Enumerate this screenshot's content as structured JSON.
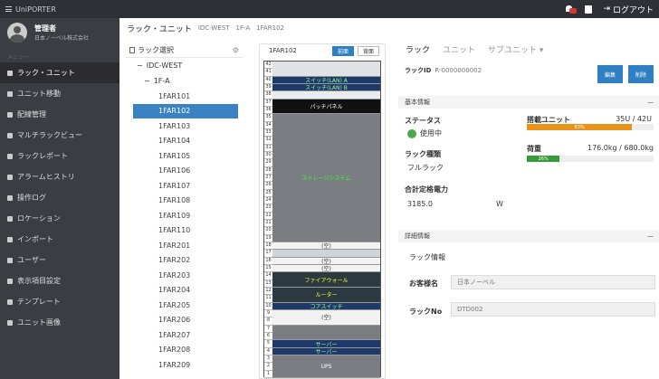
{
  "topbar": {
    "app_title": "UniPORTER",
    "logout": "ログアウト"
  },
  "user": {
    "name": "管理者",
    "company": "日本ノーベル株式会社"
  },
  "menu": {
    "header": "メニュー",
    "items": [
      {
        "label": "ラック・ユニット"
      },
      {
        "label": "ユニット移動"
      },
      {
        "label": "配線管理"
      },
      {
        "label": "マルチラックビュー"
      },
      {
        "label": "ラックレポート"
      },
      {
        "label": "アラームヒストリ"
      },
      {
        "label": "操作ログ"
      },
      {
        "label": "ロケーション"
      },
      {
        "label": "インポート"
      },
      {
        "label": "ユーザー"
      },
      {
        "label": "表示項目設定"
      },
      {
        "label": "テンプレート"
      },
      {
        "label": "ユニット画像"
      }
    ]
  },
  "breadcrumb": {
    "page": "ラック・ユニット",
    "site": "IDC-WEST",
    "floor": "1F-A",
    "rack": "1FAR102"
  },
  "tree": {
    "title": "ラック選択",
    "root": "IDC-WEST",
    "floor": "1F-A",
    "racks": [
      "1FAR101",
      "1FAR102",
      "1FAR103",
      "1FAR104",
      "1FAR105",
      "1FAR106",
      "1FAR107",
      "1FAR108",
      "1FAR109",
      "1FAR110",
      "1FAR201",
      "1FAR202",
      "1FAR203",
      "1FAR204",
      "1FAR205",
      "1FAR206",
      "1FAR207",
      "1FAR208",
      "1FAR209"
    ],
    "selected": "1FAR102"
  },
  "rackview": {
    "name": "1FAR102",
    "front": "前面",
    "back": "背面",
    "units": [
      "42",
      "41",
      "40",
      "39",
      "38",
      "37",
      "36",
      "35",
      "34",
      "33",
      "32",
      "31",
      "30",
      "29",
      "28",
      "27",
      "26",
      "25",
      "24",
      "23",
      "22",
      "21",
      "20",
      "19",
      "18",
      "17",
      "16",
      "15",
      "14",
      "13",
      "12",
      "11",
      "10",
      "9",
      "8",
      "7",
      "6",
      "5",
      "4",
      "3",
      "2",
      "1"
    ],
    "devices": {
      "patch": "パッチパネル",
      "storage": "ストレージシステム",
      "empty": "(空)",
      "firewall": "ファイアウォール",
      "router": "ルーター",
      "ups": "UPS",
      "lbl_40": "スイッチ(LAN) A",
      "lbl_39": "スイッチ(LAN) B",
      "lbl_15": "コアスイッチ",
      "lbl_8": "サーバー"
    }
  },
  "details": {
    "tabs": [
      "ラック",
      "ユニット",
      "サブユニット ▾"
    ],
    "rack_id_label": "ラックID",
    "rack_id": "R-0000000002",
    "edit": "編集",
    "delete": "削除",
    "basic_title": "基本情報",
    "status_label": "ステータス",
    "status_value": "使用中",
    "mounted_label": "搭載ユニット",
    "mounted_value": "35U / 42U",
    "mounted_pct": "83%",
    "type_label": "ラック種類",
    "type_value": "フルラック",
    "load_label": "荷重",
    "load_value": "176.0kg / 680.0kg",
    "load_pct": "26%",
    "power_label": "合計定格電力",
    "power_value": "3185.0",
    "power_unit": "W",
    "detail_title": "詳細情報",
    "rack_info": "ラック情報",
    "customer_label": "お客様名",
    "customer_value": "日本ノーベル",
    "rack_no_label": "ラックNo",
    "rack_no_value": "DTD002",
    "collapse": "—"
  },
  "colors": {
    "accent": "#2f7fc3",
    "sidebar": "#3a3d42",
    "orange": "#e8941a",
    "green": "#3a9a3a"
  },
  "progress": {
    "mounted": 0.83,
    "load": 0.26
  }
}
